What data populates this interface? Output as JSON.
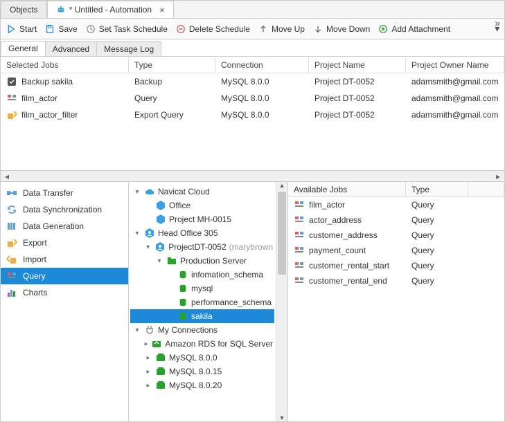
{
  "tabs": {
    "objects": "Objects",
    "doc": "* Untitled - Automation"
  },
  "toolbar": {
    "start": "Start",
    "save": "Save",
    "schedule": "Set Task Schedule",
    "delete_schedule": "Delete Schedule",
    "move_up": "Move Up",
    "move_down": "Move Down",
    "add_attachment": "Add Attachment"
  },
  "subtabs": {
    "general": "General",
    "advanced": "Advanced",
    "log": "Message Log"
  },
  "jobs": {
    "headers": {
      "sel": "Selected Jobs",
      "type": "Type",
      "conn": "Connection",
      "proj": "Project Name",
      "owner": "Project Owner Name"
    },
    "rows": [
      {
        "label": "Backup sakila",
        "type": "Backup",
        "conn": "MySQL 8.0.0",
        "proj": "Project DT-0052",
        "owner": "adamsmith@gmail.com"
      },
      {
        "label": "film_actor",
        "type": "Query",
        "conn": "MySQL 8.0.0",
        "proj": "Project DT-0052",
        "owner": "adamsmith@gmail.com"
      },
      {
        "label": "film_actor_filter",
        "type": "Export Query",
        "conn": "MySQL 8.0.0",
        "proj": "Project DT-0052",
        "owner": "adamsmith@gmail.com"
      }
    ]
  },
  "categories": [
    {
      "label": "Data Transfer",
      "icon": "transfer"
    },
    {
      "label": "Data Synchronization",
      "icon": "sync"
    },
    {
      "label": "Data Generation",
      "icon": "gen"
    },
    {
      "label": "Export",
      "icon": "export"
    },
    {
      "label": "Import",
      "icon": "import"
    },
    {
      "label": "Query",
      "icon": "query",
      "selected": true
    },
    {
      "label": "Charts",
      "icon": "charts"
    }
  ],
  "tree": {
    "navicat_cloud": "Navicat Cloud",
    "office": "Office",
    "project_mh": "Project MH-0015",
    "head_office": "Head Office 305",
    "project_dt": "ProjectDT-0052",
    "project_dt_owner": "(marybrown",
    "production": "Production Server",
    "dbs": [
      "infomation_schema",
      "mysql",
      "performance_schema",
      "sakila"
    ],
    "my_connections": "My Connections",
    "amazon": "Amazon RDS for SQL Server",
    "mysql0": "MySQL 8.0.0",
    "mysql15": "MySQL 8.0.15",
    "mysql20": "MySQL 8.0.20"
  },
  "available": {
    "headers": {
      "name": "Available Jobs",
      "type": "Type"
    },
    "rows": [
      {
        "label": "film_actor",
        "type": "Query"
      },
      {
        "label": "actor_address",
        "type": "Query"
      },
      {
        "label": "customer_address",
        "type": "Query"
      },
      {
        "label": "payment_count",
        "type": "Query"
      },
      {
        "label": "customer_rental_start",
        "type": "Query"
      },
      {
        "label": "customer_rental_end",
        "type": "Query"
      }
    ]
  }
}
